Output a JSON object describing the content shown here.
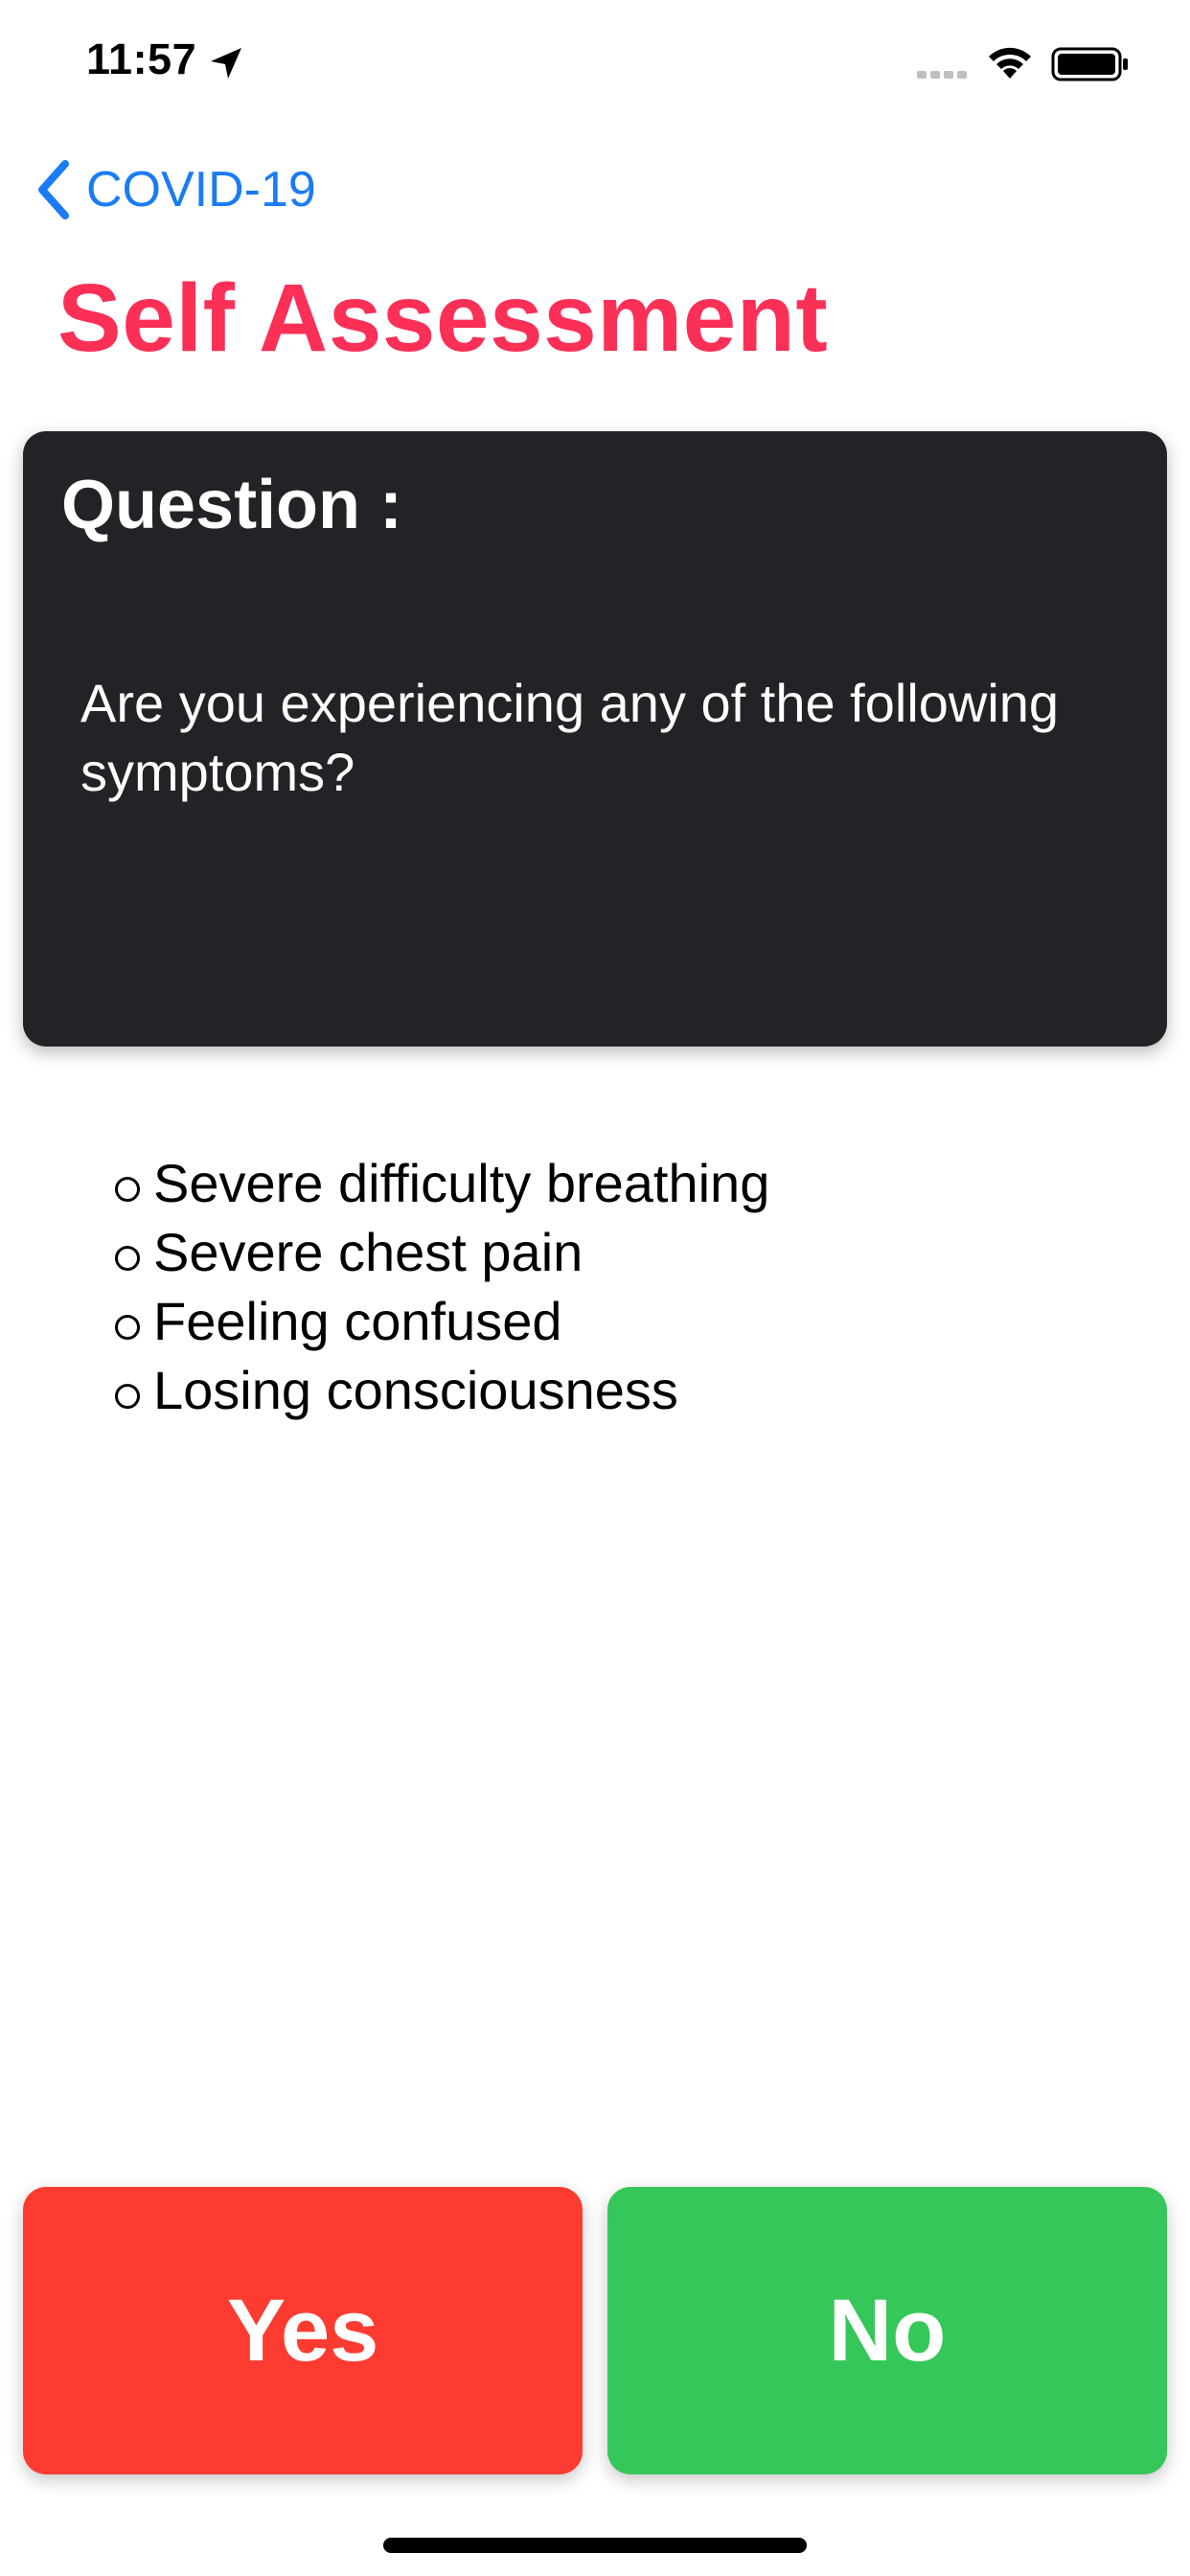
{
  "status_bar": {
    "time": "11:57",
    "icons": [
      "location-arrow-icon",
      "signal-icon",
      "wifi-icon",
      "battery-icon"
    ]
  },
  "navigation": {
    "back_label": "COVID-19",
    "back_icon": "chevron-left-icon"
  },
  "page": {
    "title": "Self Assessment"
  },
  "question_card": {
    "heading": "Question :",
    "text": "Are you experiencing any of the following symptoms?"
  },
  "symptoms": [
    "Severe difficulty breathing",
    "Severe chest pain",
    "Feeling confused",
    "Losing consciousness"
  ],
  "buttons": {
    "yes_label": "Yes",
    "no_label": "No"
  },
  "colors": {
    "title": "#fc2f57",
    "link": "#1a7cf5",
    "card_background": "#222327",
    "yes_button": "#fe3b30",
    "no_button": "#35c759"
  }
}
